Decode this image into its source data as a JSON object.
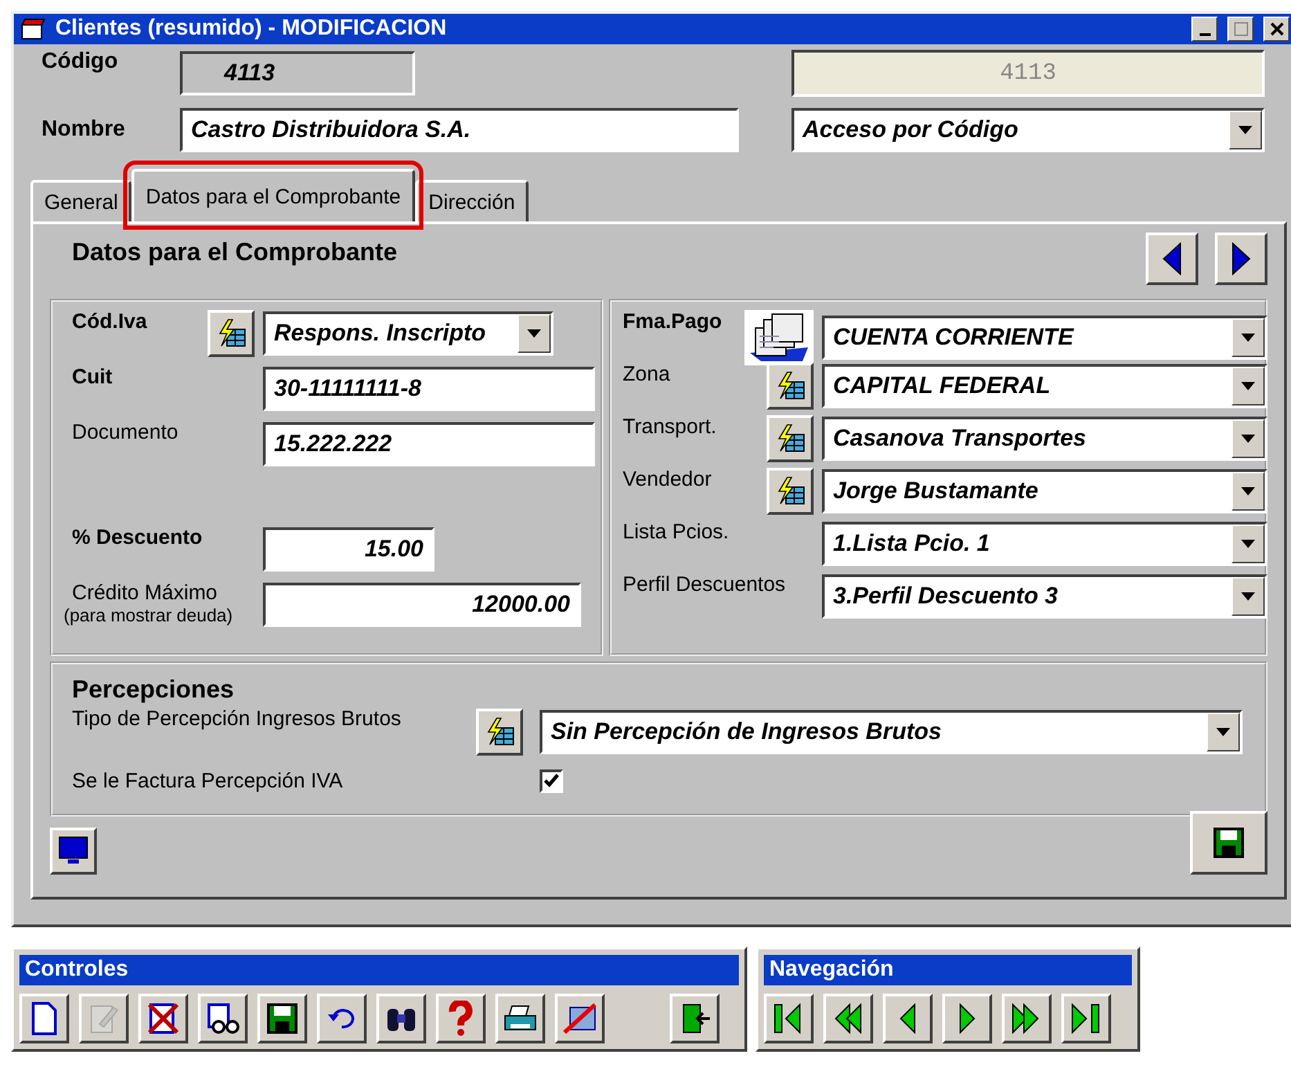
{
  "window": {
    "title": "Clientes (resumido) - MODIFICACION"
  },
  "header": {
    "code_label": "Código",
    "code_value": "4113",
    "code_mirror": "4113",
    "name_label": "Nombre",
    "name_value": "Castro Distribuidora S.A.",
    "access_select": "Acceso por Código"
  },
  "tabs": [
    {
      "label": "General",
      "selected": false,
      "highlighted": false
    },
    {
      "label": "Datos para el Comprobante",
      "selected": true,
      "highlighted": true
    },
    {
      "label": "Dirección",
      "selected": false,
      "highlighted": false
    }
  ],
  "panel": {
    "title": "Datos para el Comprobante"
  },
  "left_fields": [
    {
      "label": "Cód.Iva",
      "emphasis": true,
      "kind": "select",
      "lookup": true,
      "value": "Respons. Inscripto"
    },
    {
      "label": "Cuit",
      "emphasis": true,
      "kind": "text",
      "value": "30-11111111-8"
    },
    {
      "label": "Documento",
      "emphasis": false,
      "kind": "text",
      "value": "15.222.222"
    }
  ],
  "left_amounts": [
    {
      "label": "% Descuento",
      "emphasis": true,
      "value": "15.00"
    },
    {
      "label": "Crédito Máximo",
      "note": "(para mostrar deuda)",
      "emphasis": false,
      "value": "12000.00"
    }
  ],
  "right_fields": [
    {
      "label": "Fma.Pago",
      "emphasis": true,
      "payment_icon": true,
      "value": "CUENTA CORRIENTE"
    },
    {
      "label": "Zona",
      "emphasis": false,
      "lookup": true,
      "value": "CAPITAL FEDERAL"
    },
    {
      "label": "Transport.",
      "emphasis": false,
      "lookup": true,
      "value": "Casanova Transportes"
    },
    {
      "label": "Vendedor",
      "emphasis": false,
      "lookup": true,
      "value": "Jorge Bustamante"
    },
    {
      "label": "Lista Pcios.",
      "emphasis": false,
      "value": "1.Lista Pcio. 1"
    },
    {
      "label": "Perfil Descuentos",
      "emphasis": false,
      "value": "3.Perfil Descuento 3"
    }
  ],
  "percepciones": {
    "title": "Percepciones",
    "type_label": "Tipo de Percepción Ingresos Brutos",
    "type_value": "Sin Percepción de Ingresos Brutos",
    "iva_label": "Se le Factura Percepción IVA",
    "iva_checked": true
  },
  "controls": {
    "title": "Controles",
    "buttons": [
      {
        "kind": "new",
        "disabled": false
      },
      {
        "kind": "edit",
        "disabled": true
      },
      {
        "kind": "delete",
        "disabled": false
      },
      {
        "kind": "edit-list",
        "disabled": false
      },
      {
        "kind": "save",
        "disabled": false
      },
      {
        "kind": "undo",
        "disabled": false
      },
      {
        "kind": "search",
        "disabled": false
      },
      {
        "kind": "help",
        "disabled": false
      },
      {
        "kind": "print",
        "disabled": false
      },
      {
        "kind": "cancel",
        "disabled": false
      },
      {
        "kind": "exit",
        "disabled": false
      }
    ]
  },
  "navigation": {
    "title": "Navegación",
    "buttons": [
      {
        "kind": "first"
      },
      {
        "kind": "prev-page"
      },
      {
        "kind": "prev"
      },
      {
        "kind": "next"
      },
      {
        "kind": "next-page"
      },
      {
        "kind": "last"
      }
    ]
  }
}
